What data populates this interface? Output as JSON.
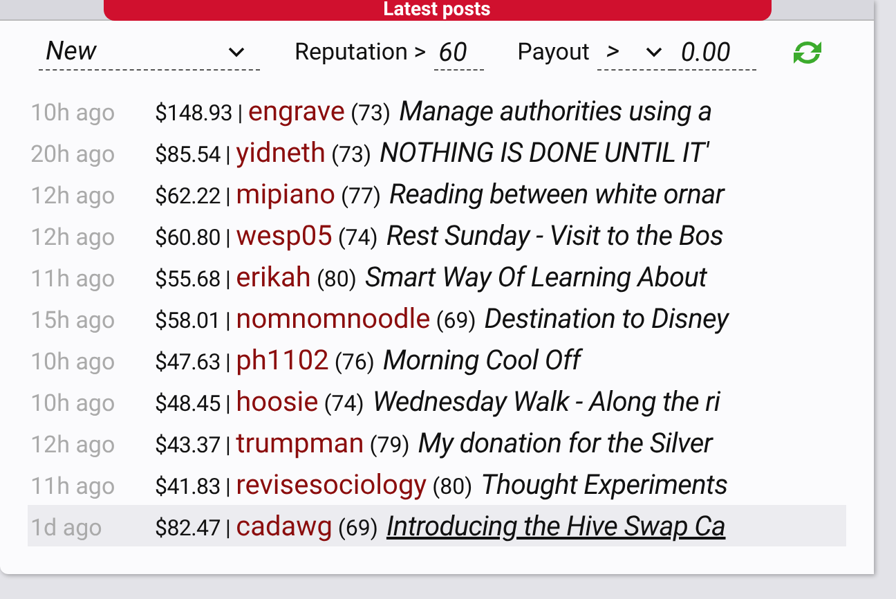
{
  "header": {
    "title": "Latest posts"
  },
  "filters": {
    "sort": "New",
    "reputation_label": "Reputation >",
    "reputation": "60",
    "payout_label": "Payout",
    "payout_operator": ">",
    "payout": "0.00"
  },
  "posts": [
    {
      "time": "10h ago",
      "payout": "$148.93 |",
      "author": "engrave",
      "reputation": "(73)",
      "title": "Manage authorities using a",
      "highlighted": false
    },
    {
      "time": "20h ago",
      "payout": "$85.54 |",
      "author": "yidneth",
      "reputation": "(73)",
      "title": "NOTHING IS DONE UNTIL IT'",
      "highlighted": false
    },
    {
      "time": "12h ago",
      "payout": "$62.22 |",
      "author": "mipiano",
      "reputation": "(77)",
      "title": "Reading between white ornar",
      "highlighted": false
    },
    {
      "time": "12h ago",
      "payout": "$60.80 |",
      "author": "wesp05",
      "reputation": "(74)",
      "title": "Rest Sunday - Visit to the Bos",
      "highlighted": false
    },
    {
      "time": "11h ago",
      "payout": "$55.68 |",
      "author": "erikah",
      "reputation": "(80)",
      "title": "Smart Way Of Learning About",
      "highlighted": false
    },
    {
      "time": "15h ago",
      "payout": "$58.01 |",
      "author": "nomnomnoodle",
      "reputation": "(69)",
      "title": "Destination to Disney",
      "highlighted": false
    },
    {
      "time": "10h ago",
      "payout": "$47.63 |",
      "author": "ph1102",
      "reputation": "(76)",
      "title": "Morning Cool Off",
      "highlighted": false
    },
    {
      "time": "10h ago",
      "payout": "$48.45 |",
      "author": "hoosie",
      "reputation": "(74)",
      "title": "Wednesday Walk - Along the ri",
      "highlighted": false
    },
    {
      "time": "12h ago",
      "payout": "$43.37 |",
      "author": "trumpman",
      "reputation": "(79)",
      "title": "My donation for the Silver",
      "highlighted": false
    },
    {
      "time": "11h ago",
      "payout": "$41.83 |",
      "author": "revisesociology",
      "reputation": "(80)",
      "title": "Thought Experiments",
      "highlighted": false
    },
    {
      "time": "1d ago",
      "payout": "$82.47 |",
      "author": "cadawg",
      "reputation": "(69)",
      "title": "Introducing the Hive Swap Ca",
      "highlighted": true
    }
  ]
}
